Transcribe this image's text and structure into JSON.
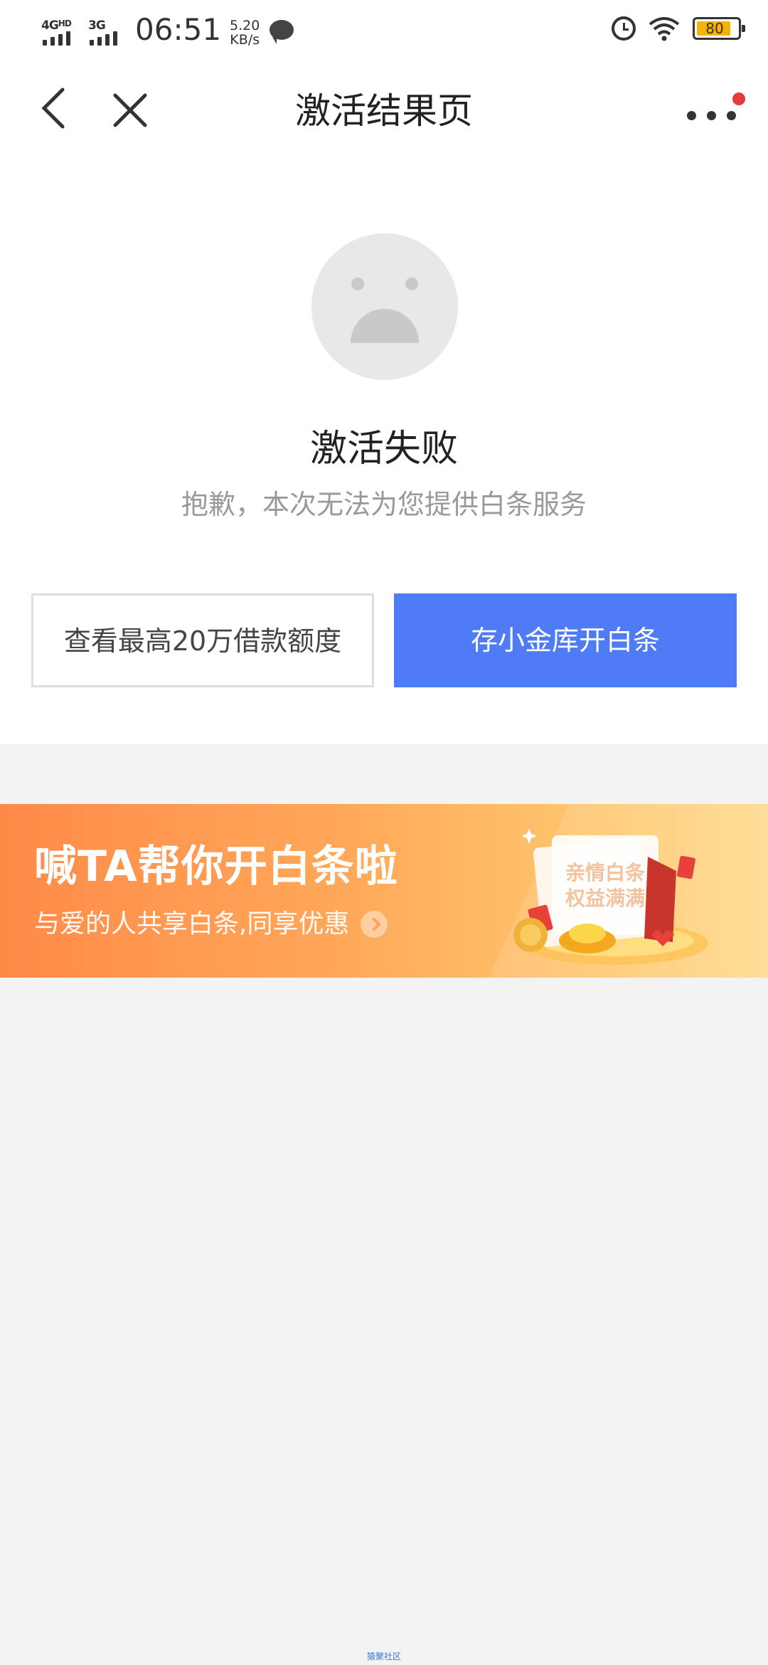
{
  "status_bar": {
    "network_1": "4G",
    "network_1_sup": "HD",
    "network_2": "3G",
    "time": "06:51",
    "speed_value": "5.20",
    "speed_unit": "KB/s",
    "battery_level": "80",
    "battery_color": "#f4b400"
  },
  "nav": {
    "title": "激活结果页",
    "back_icon": "chevron-left-icon",
    "close_icon": "close-icon",
    "more_icon": "more-dots-icon",
    "badge_color": "#e63b3b"
  },
  "result": {
    "icon": "sad-face-icon",
    "title": "激活失败",
    "subtitle": "抱歉，本次无法为您提供白条服务",
    "secondary_button": "查看最高20万借款额度",
    "primary_button": "存小金库开白条",
    "primary_color": "#4f7cf6"
  },
  "banner": {
    "title": "喊TA帮你开白条啦",
    "subtitle": "与爱的人共享白条,同享优惠",
    "art_line1": "亲情白条",
    "art_line2": "权益满满"
  },
  "footer": {
    "watermark": "猿聚社区"
  }
}
